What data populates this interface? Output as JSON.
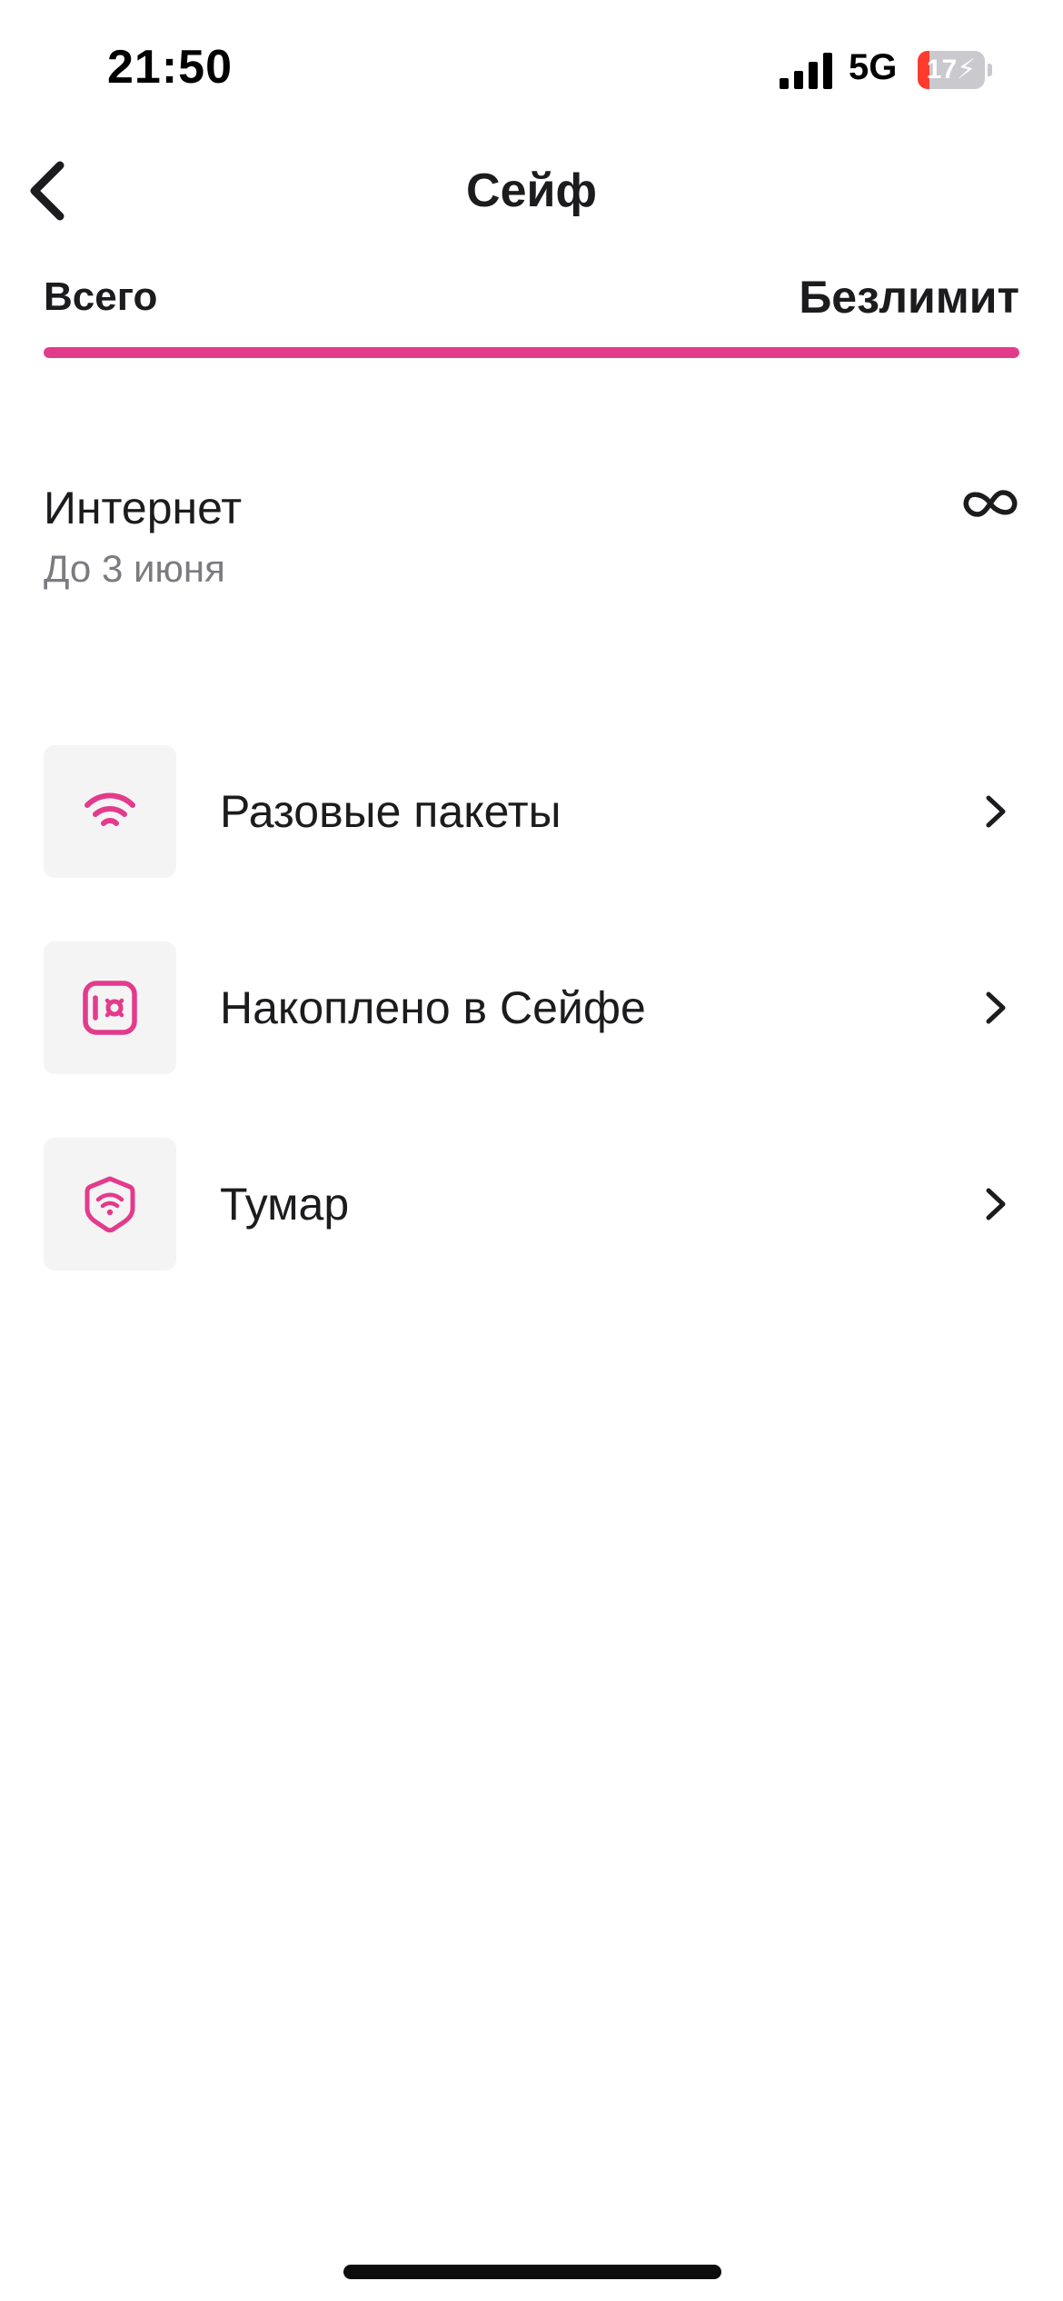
{
  "status_bar": {
    "time": "21:50",
    "network": "5G",
    "battery_percent": "17",
    "battery_level": 0.17,
    "icons": [
      "signal-bars-icon",
      "battery-charging-icon"
    ]
  },
  "header": {
    "title": "Сейф",
    "back_icon": "chevron-left-icon"
  },
  "summary": {
    "label": "Всего",
    "value": "Безлимит",
    "progress_fraction": 1.0,
    "accent_color": "#e33b8b"
  },
  "internet": {
    "title": "Интернет",
    "subtitle": "До 3 июня",
    "amount_icon": "infinity-icon"
  },
  "menu": {
    "items": [
      {
        "label": "Разовые пакеты",
        "icon": "wifi-icon"
      },
      {
        "label": "Накоплено в Сейфе",
        "icon": "safe-icon"
      },
      {
        "label": "Тумар",
        "icon": "shield-wifi-icon"
      }
    ],
    "chevron_icon": "chevron-right-icon",
    "icon_color": "#e33b8b"
  }
}
